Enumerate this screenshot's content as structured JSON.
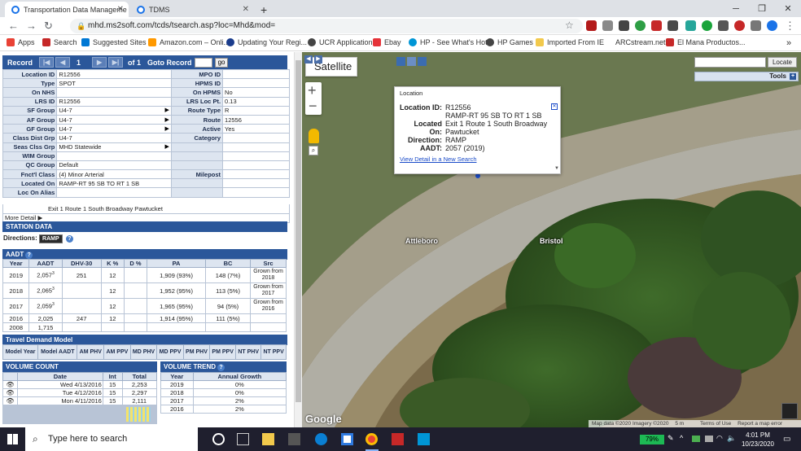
{
  "browser": {
    "tabs": [
      {
        "title": "Transportation Data Manageme",
        "active": true
      },
      {
        "title": "TDMS",
        "active": false
      }
    ],
    "new_tab": "+",
    "url": "mhd.ms2soft.com/tcds/tsearch.asp?loc=Mhd&mod=",
    "bookmarks": [
      "Apps",
      "Search",
      "Suggested Sites",
      "Amazon.com – Onli...",
      "Updating Your Regi...",
      "UCR Application",
      "Ebay",
      "HP - See What's Hot",
      "HP Games",
      "Imported From IE",
      "ARCstream.net",
      "El Mana Productos..."
    ],
    "more": "»"
  },
  "record": {
    "label": "Record",
    "current": "1",
    "of": "of 1",
    "goto_label": "Goto Record",
    "go": "go"
  },
  "info_rows": [
    {
      "l": "Location ID",
      "v": "R12556",
      "r": "MPO ID",
      "rv": ""
    },
    {
      "l": "Type",
      "v": "SPOT",
      "r": "HPMS ID",
      "rv": ""
    },
    {
      "l": "On NHS",
      "v": "",
      "r": "On HPMS",
      "rv": "No"
    },
    {
      "l": "LRS ID",
      "v": "R12556",
      "r": "LRS Loc Pt.",
      "rv": "0.13"
    },
    {
      "l": "SF Group",
      "v": "U4-7",
      "r": "Route Type",
      "rv": "R"
    },
    {
      "l": "AF Group",
      "v": "U4-7",
      "r": "Route",
      "rv": "12556"
    },
    {
      "l": "GF Group",
      "v": "U4-7",
      "r": "Active",
      "rv": "Yes"
    },
    {
      "l": "Class Dist Grp",
      "v": "U4-7",
      "r": "Category",
      "rv": ""
    },
    {
      "l": "Seas Clss Grp",
      "v": "MHD Statewide",
      "r": "",
      "rv": ""
    },
    {
      "l": "WIM Group",
      "v": "",
      "r": "",
      "rv": ""
    },
    {
      "l": "QC Group",
      "v": "Default",
      "r": "",
      "rv": ""
    },
    {
      "l": "Fnct'l Class",
      "v": "(4) Minor Arterial",
      "r": "Milepost",
      "rv": ""
    },
    {
      "l": "Located On",
      "v": "RAMP-RT 95 SB TO RT 1 SB",
      "r": "",
      "rv": ""
    },
    {
      "l": "Loc On Alias",
      "v": "",
      "r": "",
      "rv": ""
    }
  ],
  "alias_line": "Exit 1 Route 1 South Broadway Pawtucket",
  "more_detail": "More Detail",
  "station": {
    "header": "STATION DATA",
    "directions_label": "Directions:",
    "direction": "RAMP"
  },
  "aadt": {
    "header": "AADT",
    "columns": [
      "Year",
      "AADT",
      "DHV-30",
      "K %",
      "D %",
      "PA",
      "BC",
      "Src"
    ],
    "rows": [
      {
        "year": "2019",
        "aadt": "2,057",
        "sup": "3",
        "dhv": "251",
        "k": "12",
        "d": "",
        "pa": "1,909 (93%)",
        "bc": "148 (7%)",
        "src": "Grown from 2018"
      },
      {
        "year": "2018",
        "aadt": "2,065",
        "sup": "3",
        "dhv": "",
        "k": "12",
        "d": "",
        "pa": "1,952 (95%)",
        "bc": "113 (5%)",
        "src": "Grown from 2017"
      },
      {
        "year": "2017",
        "aadt": "2,059",
        "sup": "3",
        "dhv": "",
        "k": "12",
        "d": "",
        "pa": "1,965 (95%)",
        "bc": "94 (5%)",
        "src": "Grown from 2016"
      },
      {
        "year": "2016",
        "aadt": "2,025",
        "sup": "",
        "dhv": "247",
        "k": "12",
        "d": "",
        "pa": "1,914 (95%)",
        "bc": "111 (5%)",
        "src": ""
      },
      {
        "year": "2008",
        "aadt": "1,715",
        "sup": "",
        "dhv": "",
        "k": "",
        "d": "",
        "pa": "",
        "bc": "",
        "src": ""
      }
    ]
  },
  "tdm": {
    "header": "Travel Demand Model",
    "columns": [
      "Model Year",
      "Model AADT",
      "AM PHV",
      "AM PPV",
      "MD PHV",
      "MD PPV",
      "PM PHV",
      "PM PPV",
      "NT PHV",
      "NT PPV"
    ]
  },
  "volume_count": {
    "header": "VOLUME COUNT",
    "columns": [
      "Date",
      "Int",
      "Total"
    ],
    "rows": [
      {
        "date": "Wed 4/13/2016",
        "int": "15",
        "total": "2,253"
      },
      {
        "date": "Tue 4/12/2016",
        "int": "15",
        "total": "2,297"
      },
      {
        "date": "Mon 4/11/2016",
        "int": "15",
        "total": "2,111"
      }
    ]
  },
  "volume_trend": {
    "header": "VOLUME TREND",
    "columns": [
      "Year",
      "Annual Growth"
    ],
    "rows": [
      {
        "year": "2019",
        "growth": "0%"
      },
      {
        "year": "2018",
        "growth": "0%"
      },
      {
        "year": "2017",
        "growth": "2%"
      },
      {
        "year": "2016",
        "growth": "2%"
      }
    ]
  },
  "map": {
    "type_button": "Satellite",
    "locate": "Locate",
    "tools": "Tools",
    "labels": [
      "Attleboro",
      "Bristol"
    ],
    "google": "Google",
    "attribution": "Map data ©2020 Imagery ©2020",
    "scale": "5 m",
    "terms": "Terms of Use",
    "report": "Report a map error",
    "popup": {
      "tab": "Location",
      "location_id_label": "Location ID:",
      "location_id": "R12556",
      "ramp_line1": "RAMP-RT 95 SB TO RT 1 SB",
      "located_on_label": "Located On:",
      "located_on": "Exit 1 Route 1 South Broadway Pawtucket",
      "direction_label": "Direction:",
      "direction": "RAMP",
      "aadt_label": "AADT:",
      "aadt": "2057 (2019)",
      "link": "View Detail in a New Search"
    }
  },
  "taskbar": {
    "search_placeholder": "Type here to search",
    "battery": "79%",
    "time": "4:01 PM",
    "date": "10/23/2020"
  }
}
